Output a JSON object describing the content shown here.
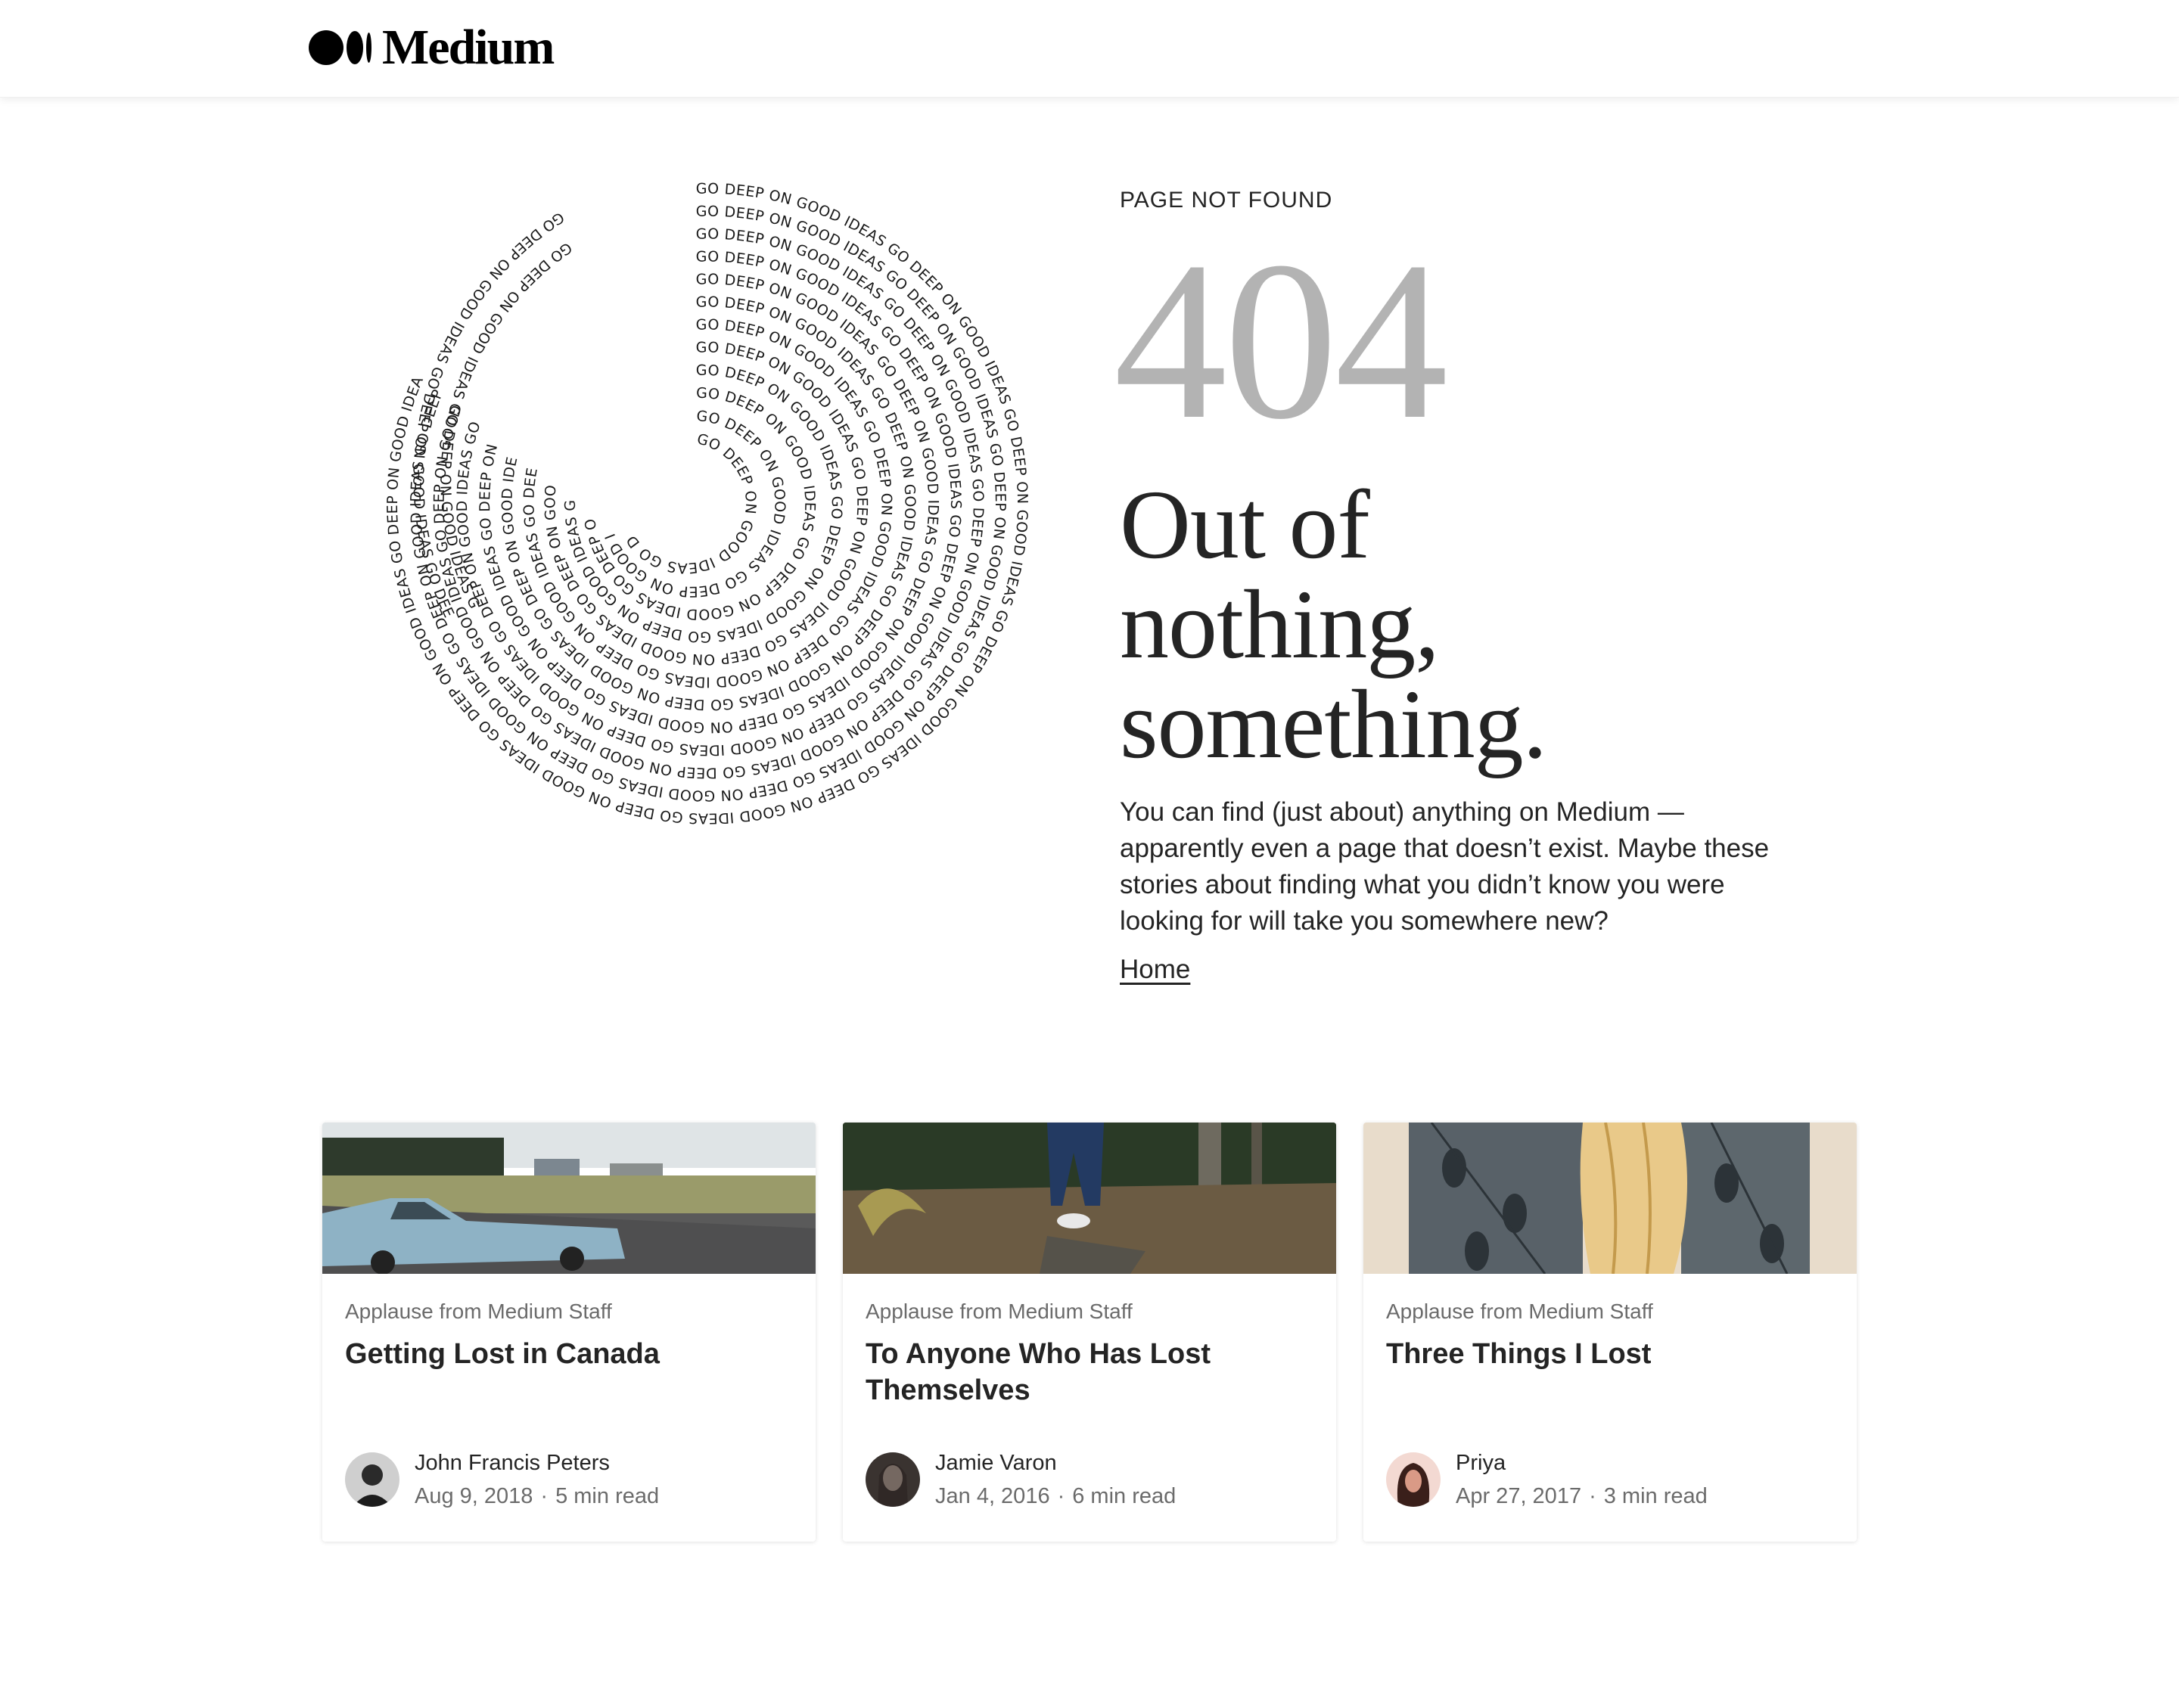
{
  "header": {
    "logo_text": "Medium"
  },
  "art": {
    "spiral_phrase": "GO DEEP ON GOOD IDEAS"
  },
  "hero": {
    "kicker": "PAGE NOT FOUND",
    "code": "404",
    "headline_lines": [
      "Out of",
      "nothing,",
      "something."
    ],
    "body": "You can find (just about) anything on Medium — apparently even a page that doesn’t exist. Maybe these stories about finding what you didn’t know you were looking for will take you somewhere new?",
    "home_link": "Home"
  },
  "cards": [
    {
      "kicker": "Applause from Medium Staff",
      "title": "Getting Lost in Canada",
      "author": "John Francis Peters",
      "date": "Aug 9, 2018",
      "read_time": "5 min read"
    },
    {
      "kicker": "Applause from Medium Staff",
      "title": "To Anyone Who Has Lost Themselves",
      "author": "Jamie Varon",
      "date": "Jan 4, 2016",
      "read_time": "6 min read"
    },
    {
      "kicker": "Applause from Medium Staff",
      "title": "Three Things I Lost",
      "author": "Priya",
      "date": "Apr 27, 2017",
      "read_time": "3 min read"
    }
  ],
  "meta_separator": "·"
}
